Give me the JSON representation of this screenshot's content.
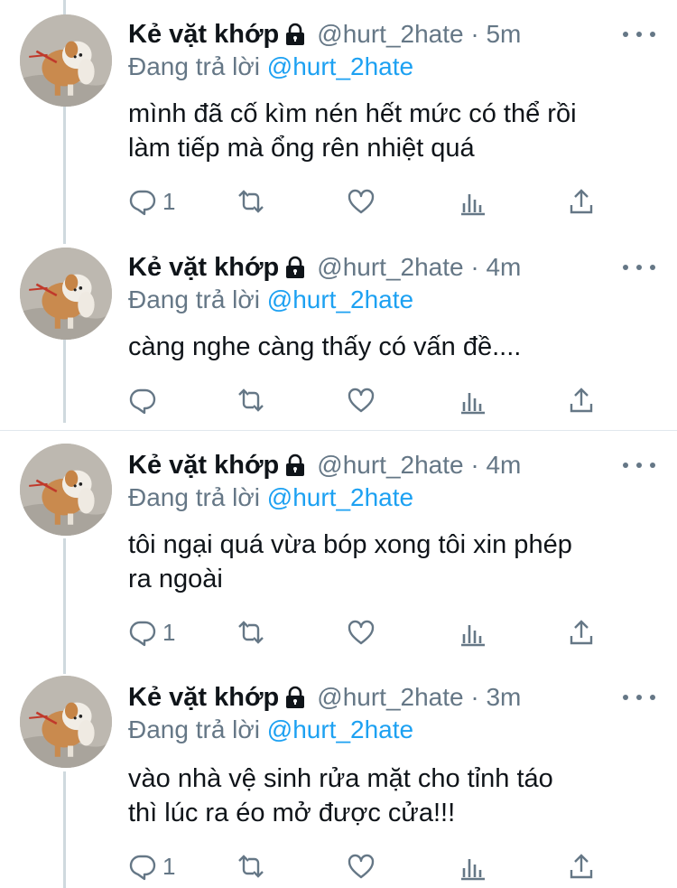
{
  "tweets": [
    {
      "name": "Kẻ vặt khớp",
      "handle": "@hurt_2hate · 5m",
      "replying_prefix": "Đang trả lời",
      "replying_to": "@hurt_2hate",
      "lines": [
        "mình đã cố kìm nén hết mức có thể rồi",
        "làm tiếp mà ổng rên nhiệt quá"
      ],
      "reply_count": "1"
    },
    {
      "name": "Kẻ vặt khớp",
      "handle": "@hurt_2hate · 4m",
      "replying_prefix": "Đang trả lời",
      "replying_to": "@hurt_2hate",
      "lines": [
        "càng nghe càng thấy có vấn đề...."
      ],
      "reply_count": ""
    },
    {
      "name": "Kẻ vặt khớp",
      "handle": "@hurt_2hate · 4m",
      "replying_prefix": "Đang trả lời",
      "replying_to": "@hurt_2hate",
      "lines": [
        "tôi ngại quá vừa bóp xong tôi xin phép",
        "ra ngoài"
      ],
      "reply_count": "1"
    },
    {
      "name": "Kẻ vặt khớp",
      "handle": "@hurt_2hate · 3m",
      "replying_prefix": "Đang trả lời",
      "replying_to": "@hurt_2hate",
      "lines": [
        "vào nhà vệ sinh rửa mặt cho tỉnh  táo",
        "thì lúc ra éo mở được cửa!!!"
      ],
      "reply_count": "1"
    }
  ],
  "colors": {
    "text": "#0f1419",
    "secondary": "#657786",
    "link": "#1da1f2",
    "thread_line": "#cfd9de",
    "divider": "#e1e8ed"
  },
  "icons": [
    "lock-icon",
    "more-icon",
    "reply-icon",
    "retweet-icon",
    "like-icon",
    "analytics-icon",
    "share-icon"
  ]
}
